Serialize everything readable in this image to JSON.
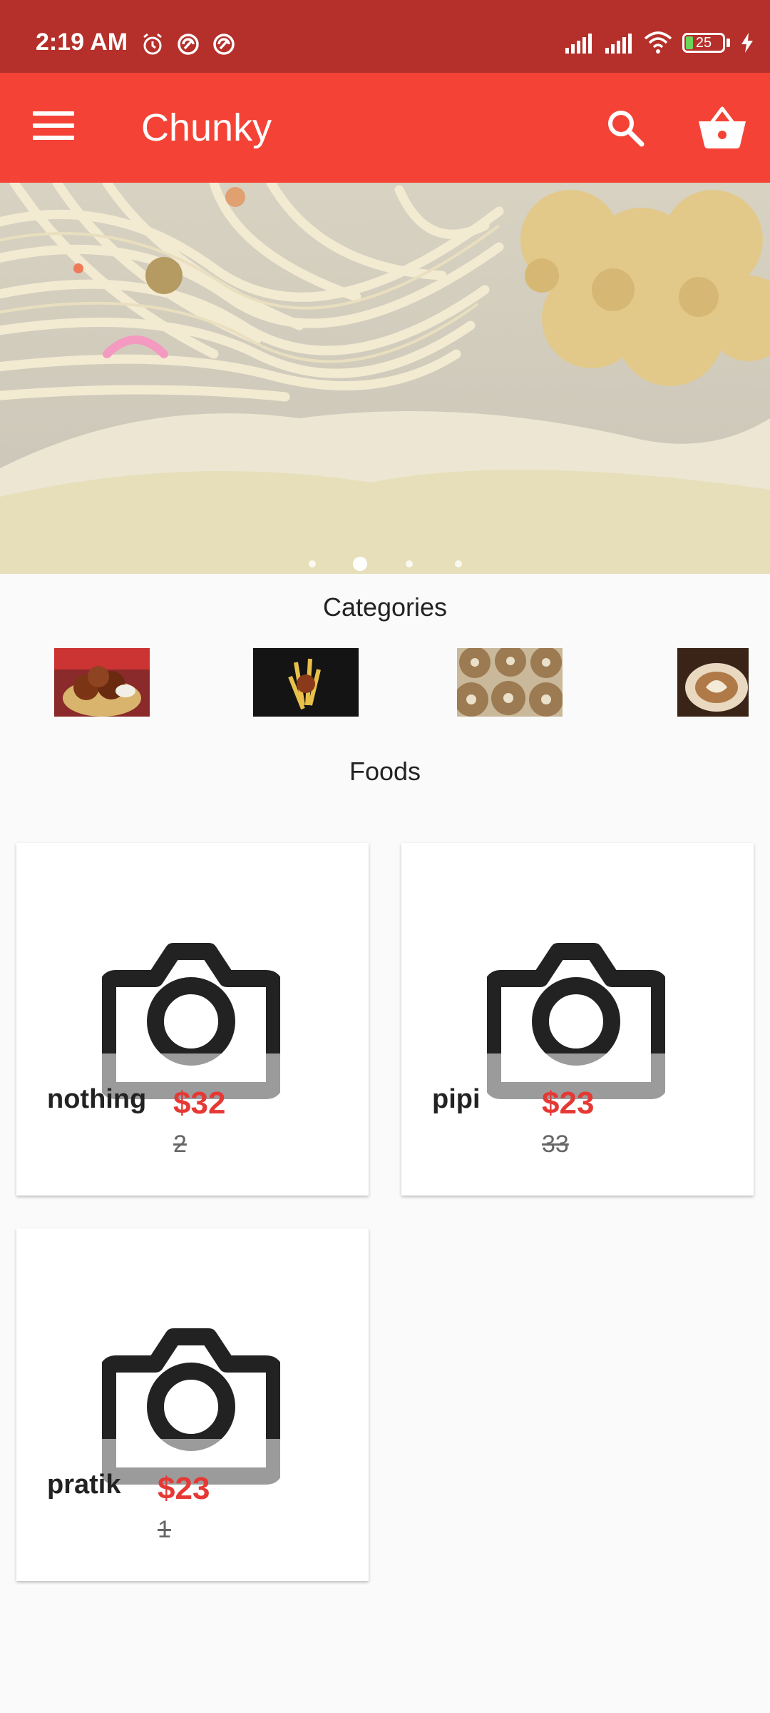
{
  "status": {
    "time": "2:19 AM",
    "battery": "25"
  },
  "appbar": {
    "title": "Chunky",
    "menu_icon": "hamburger-menu-icon",
    "search_icon": "search-icon",
    "cart_icon": "shopping-basket-icon"
  },
  "banner": {
    "slide_count": 4,
    "active_slide": 2
  },
  "categories": {
    "title": "Categories"
  },
  "foods": {
    "title": "Foods",
    "items": [
      {
        "name": "nothing",
        "price": "$32",
        "old_price": "2"
      },
      {
        "name": "pipi",
        "price": "$23",
        "old_price": "33"
      },
      {
        "name": "pratik",
        "price": "$23",
        "old_price": "1"
      }
    ]
  },
  "colors": {
    "status_bar": "#b5302b",
    "app_bar": "#f44336",
    "price": "#e53935"
  }
}
